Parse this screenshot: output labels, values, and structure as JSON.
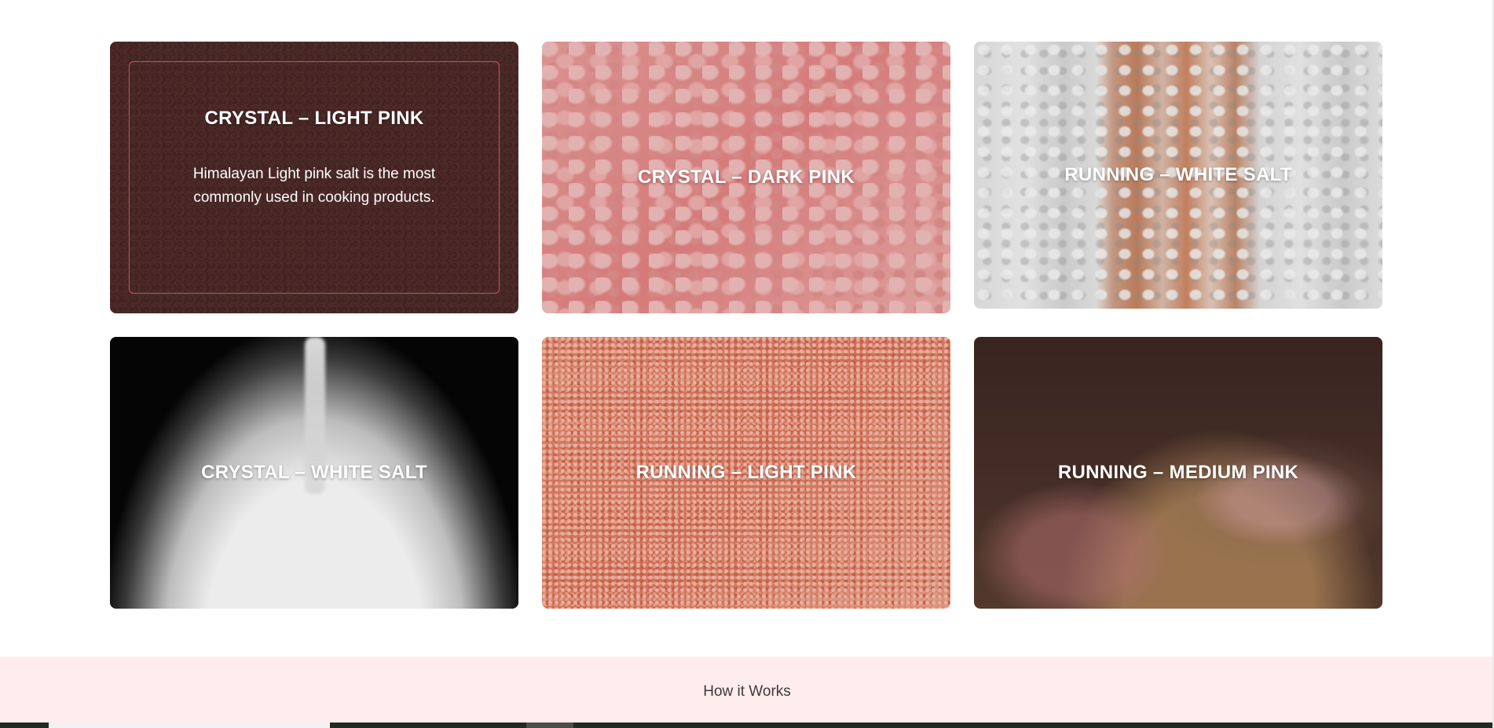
{
  "products": [
    {
      "title": "CRYSTAL – LIGHT PINK",
      "description": "Himalayan Light pink salt is the most commonly used in cooking products.",
      "state": "hover"
    },
    {
      "title": "CRYSTAL – DARK PINK"
    },
    {
      "title": "RUNNING – WHITE SALT"
    },
    {
      "title": "CRYSTAL – WHITE SALT"
    },
    {
      "title": "RUNNING – LIGHT PINK"
    },
    {
      "title": "RUNNING – MEDIUM PINK"
    }
  ],
  "how_it_works": {
    "heading": "How it Works"
  },
  "colors": {
    "band_background": "#ffecec",
    "hover_frame": "#e0475a"
  }
}
